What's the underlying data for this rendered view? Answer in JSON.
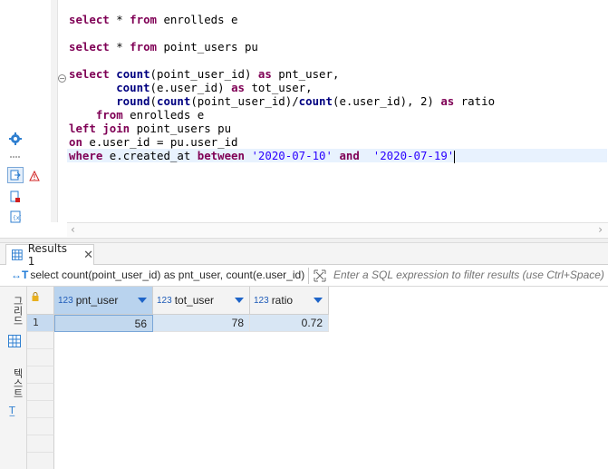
{
  "editor": {
    "lines": [
      [
        {
          "t": "select",
          "c": "kw"
        },
        {
          "t": " * "
        },
        {
          "t": "from",
          "c": "kw"
        },
        {
          "t": " enrolleds e"
        }
      ],
      [],
      [
        {
          "t": "select",
          "c": "kw"
        },
        {
          "t": " * "
        },
        {
          "t": "from",
          "c": "kw"
        },
        {
          "t": " point_users pu"
        }
      ],
      [],
      [
        {
          "t": "select",
          "c": "kw"
        },
        {
          "t": " "
        },
        {
          "t": "count",
          "c": "fn"
        },
        {
          "t": "(point_user_id) "
        },
        {
          "t": "as",
          "c": "kw"
        },
        {
          "t": " pnt_user,"
        }
      ],
      [
        {
          "t": "       "
        },
        {
          "t": "count",
          "c": "fn"
        },
        {
          "t": "(e.user_id) "
        },
        {
          "t": "as",
          "c": "kw"
        },
        {
          "t": " tot_user,"
        }
      ],
      [
        {
          "t": "       "
        },
        {
          "t": "round",
          "c": "fn"
        },
        {
          "t": "("
        },
        {
          "t": "count",
          "c": "fn"
        },
        {
          "t": "(point_user_id)/"
        },
        {
          "t": "count",
          "c": "fn"
        },
        {
          "t": "(e.user_id), 2) "
        },
        {
          "t": "as",
          "c": "kw"
        },
        {
          "t": " ratio"
        }
      ],
      [
        {
          "t": "    "
        },
        {
          "t": "from",
          "c": "kw"
        },
        {
          "t": " enrolleds e"
        }
      ],
      [
        {
          "t": "left join",
          "c": "kw"
        },
        {
          "t": " point_users pu"
        }
      ],
      [
        {
          "t": "on",
          "c": "kw"
        },
        {
          "t": " e.user_id = pu.user_id"
        }
      ],
      [
        {
          "t": "where",
          "c": "kw"
        },
        {
          "t": " e.created_at "
        },
        {
          "t": "between",
          "c": "kw"
        },
        {
          "t": " "
        },
        {
          "t": "'2020-07-10'",
          "c": "str"
        },
        {
          "t": " "
        },
        {
          "t": "and",
          "c": "kw"
        },
        {
          "t": "  "
        },
        {
          "t": "'2020-07-19'",
          "c": "str"
        }
      ]
    ],
    "fold_symbol": "−"
  },
  "results": {
    "tab_label": "Results 1",
    "close_symbol": "✕",
    "filter_sql": "select count(point_user_id) as pnt_user, count(e.user_id) a",
    "filter_sql_prefix": "↔T",
    "filter_placeholder": "Enter a SQL expression to filter results (use Ctrl+Space)",
    "side_tabs": [
      "그리드",
      "텍스트"
    ],
    "columns": [
      {
        "type": "123",
        "name": "pnt_user"
      },
      {
        "type": "123",
        "name": "tot_user"
      },
      {
        "type": "123",
        "name": "ratio"
      }
    ],
    "rows": [
      {
        "num": "1",
        "values": [
          "56",
          "78",
          "0.72"
        ]
      }
    ]
  },
  "colors": {
    "keyword": "#7f0055",
    "function": "#000080",
    "string": "#2a00ff",
    "selection": "#c2d8ee"
  }
}
